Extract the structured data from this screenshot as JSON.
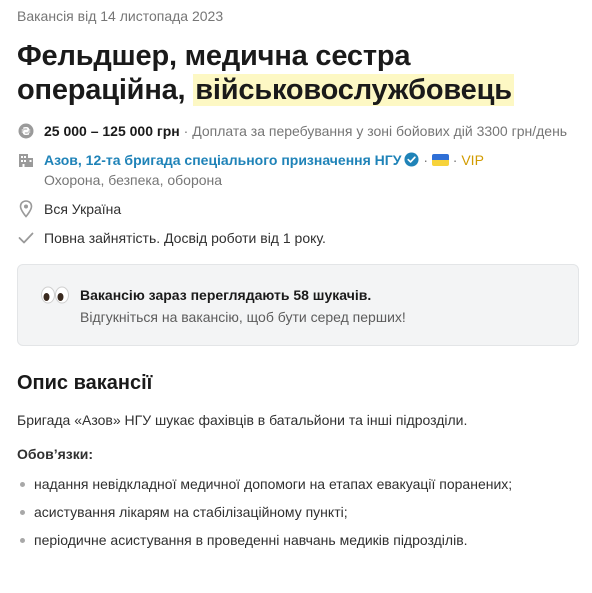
{
  "posted": "Вакансія від 14 листопада 2023",
  "title": {
    "main": "Фельдшер, медична сестра операційна,",
    "highlight": "військовослужбовець"
  },
  "salary": {
    "amount": "25 000 – 125 000 грн",
    "separator": "·",
    "note": "Доплата за перебування у зоні бойових дій 3300 грн/день"
  },
  "company": {
    "name": "Азов, 12-та бригада спеціального призначення НГУ",
    "separator1": "·",
    "separator2": "·",
    "vip": "VIP",
    "industry": "Охорона, безпека, оборона"
  },
  "location": "Вся Україна",
  "employment": "Повна зайнятість. Досвід роботи від 1 року.",
  "callout": {
    "line1": "Вакансію зараз переглядають 58 шукачів.",
    "line2": "Відгукніться на вакансію, щоб бути серед перших!"
  },
  "description": {
    "heading": "Опис вакансії",
    "text": "Бригада «Азов» НГУ шукає фахівців в батальйони та інші підрозділи.",
    "duties_heading": "Обов’язки:",
    "duties": [
      "надання невідкладної медичної допомоги на етапах евакуації поранених;",
      "асистування лікарям на стабілізаційному пункті;",
      "періодичне асистування в проведенні навчань медиків підрозділів."
    ]
  },
  "icons": {
    "salary": "currency-icon",
    "company": "building-icon",
    "verified": "verified-check-icon",
    "flag": "ukraine-flag-icon",
    "location": "location-pin-icon",
    "employment": "checkmark-icon",
    "callout": "eyes-icon"
  },
  "colors": {
    "link": "#1f83b8",
    "vip": "#d19b00",
    "highlight": "#fdf8c4",
    "muted": "#767676"
  }
}
